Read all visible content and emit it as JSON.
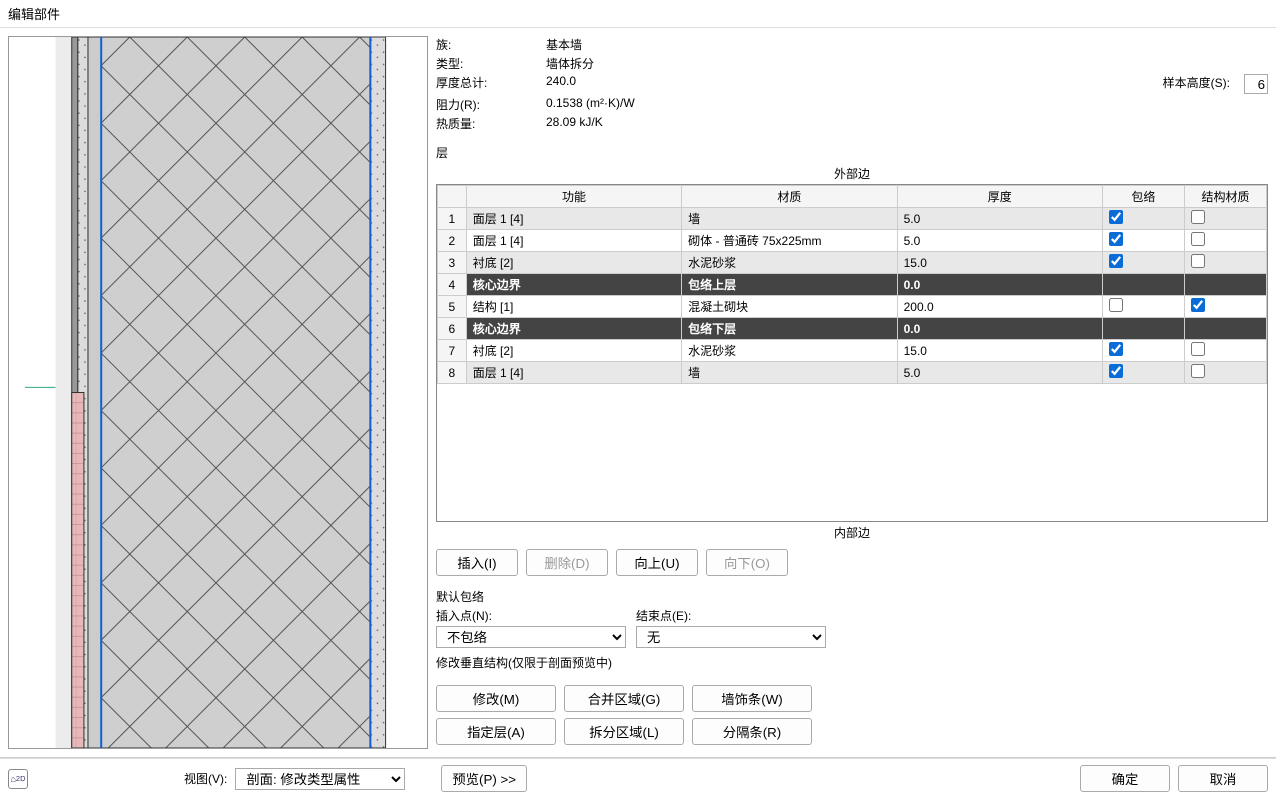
{
  "title": "编辑部件",
  "props": {
    "family_label": "族:",
    "family_value": "基本墙",
    "type_label": "类型:",
    "type_value": "墙体拆分",
    "thickness_label": "厚度总计:",
    "thickness_value": "240.0",
    "resistance_label": "阻力(R):",
    "resistance_value": "0.1538 (m²·K)/W",
    "thermal_label": "热质量:",
    "thermal_value": "28.09 kJ/K",
    "sample_height_label": "样本高度(S):",
    "sample_height_value": "6"
  },
  "edges": {
    "outer": "外部边",
    "inner": "内部边"
  },
  "layers_label": "层",
  "columns": {
    "function": "功能",
    "material": "材质",
    "thickness": "厚度",
    "wrap": "包络",
    "struct": "结构材质"
  },
  "rows": [
    {
      "n": "1",
      "func": "面层 1 [4]",
      "mat": "墙",
      "thk": "5.0",
      "wrap": true,
      "struct": false,
      "shade": true
    },
    {
      "n": "2",
      "func": "面层 1 [4]",
      "mat": "砌体 - 普通砖 75x225mm",
      "thk": "5.0",
      "wrap": true,
      "struct": false,
      "shade": false
    },
    {
      "n": "3",
      "func": "衬底 [2]",
      "mat": "水泥砂浆",
      "thk": "15.0",
      "wrap": true,
      "struct": false,
      "shade": true
    },
    {
      "n": "4",
      "func": "核心边界",
      "mat": "包络上层",
      "thk": "0.0",
      "core": true
    },
    {
      "n": "5",
      "func": "结构 [1]",
      "mat": "混凝土砌块",
      "thk": "200.0",
      "wrap": false,
      "struct": true,
      "shade": false
    },
    {
      "n": "6",
      "func": "核心边界",
      "mat": "包络下层",
      "thk": "0.0",
      "core": true
    },
    {
      "n": "7",
      "func": "衬底 [2]",
      "mat": "水泥砂浆",
      "thk": "15.0",
      "wrap": true,
      "struct": false,
      "shade": false
    },
    {
      "n": "8",
      "func": "面层 1 [4]",
      "mat": "墙",
      "thk": "5.0",
      "wrap": true,
      "struct": false,
      "shade": true
    }
  ],
  "buttons": {
    "insert": "插入(I)",
    "delete": "删除(D)",
    "up": "向上(U)",
    "down": "向下(O)",
    "modify": "修改(M)",
    "merge": "合并区域(G)",
    "sweep": "墙饰条(W)",
    "assign": "指定层(A)",
    "split": "拆分区域(L)",
    "reveal": "分隔条(R)",
    "preview": "预览(P) >>",
    "ok": "确定",
    "cancel": "取消"
  },
  "default_wrap": {
    "group": "默认包络",
    "insert_label": "插入点(N):",
    "insert_value": "不包络",
    "end_label": "结束点(E):",
    "end_value": "无"
  },
  "modify_vert": {
    "group": "修改垂直结构(仅限于剖面预览中)"
  },
  "view": {
    "label": "视图(V):",
    "value": "剖面: 修改类型属性"
  }
}
